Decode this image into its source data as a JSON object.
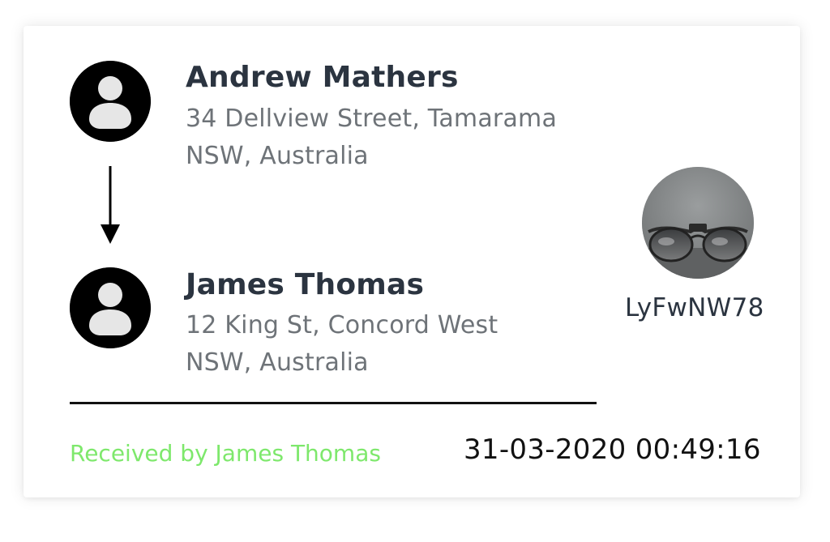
{
  "sender": {
    "name": "Andrew Mathers",
    "address_line1": "34 Dellview Street, Tamarama",
    "address_line2": "NSW, Australia",
    "avatar_icon": "user-avatar-icon"
  },
  "receiver": {
    "name": "James Thomas",
    "address_line1": "12 King St, Concord West",
    "address_line2": "NSW, Australia",
    "avatar_icon": "user-avatar-icon"
  },
  "transfer": {
    "direction_icon": "arrow-down-icon",
    "status": "Received by James Thomas",
    "timestamp": "31-03-2020 00:49:16"
  },
  "item": {
    "code": "LyFwNW78",
    "photo_subject": "sunglasses"
  },
  "colors": {
    "status_green": "#7ee86c",
    "name_dark": "#2b3440",
    "address_gray": "#6e7378"
  }
}
